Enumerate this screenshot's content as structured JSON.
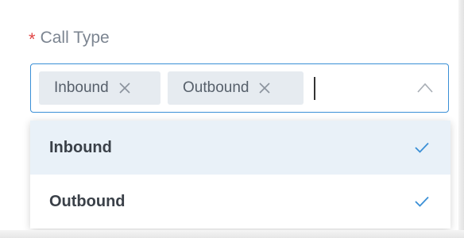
{
  "field": {
    "required_mark": "*",
    "label": "Call Type"
  },
  "select": {
    "tags": [
      {
        "label": "Inbound",
        "remove_icon": "close-icon"
      },
      {
        "label": "Outbound",
        "remove_icon": "close-icon"
      }
    ],
    "toggle_icon": "chevron-up-icon",
    "state": "open"
  },
  "dropdown": {
    "options": [
      {
        "label": "Inbound",
        "selected": true,
        "highlighted": true
      },
      {
        "label": "Outbound",
        "selected": true,
        "highlighted": false
      }
    ],
    "check_icon": "checkmark-icon"
  },
  "colors": {
    "accent": "#3a8fd6",
    "required": "#e04545",
    "tag_background": "#e6ebf0",
    "highlight_background": "#e9f1f8"
  }
}
